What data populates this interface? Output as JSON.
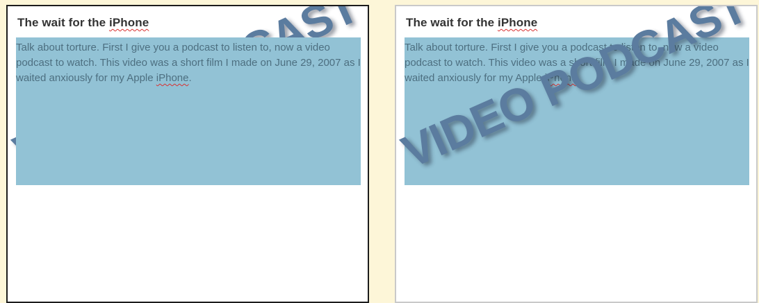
{
  "panels": [
    {
      "title_prefix": "The wait for the ",
      "title_link": "iPhone",
      "body_prefix": "Talk about torture. First I give you a podcast to listen to, now a video podcast to watch. This video was a short film I made on June 29, 2007 as I waited anxiously for my Apple ",
      "body_link": "iPhone",
      "body_suffix": ".",
      "stamp_text": "VIDEO PODCAST"
    },
    {
      "title_prefix": "The wait for the ",
      "title_link": "iPhone",
      "body_prefix": "Talk about torture. First I give you a podcast to listen to, now a video podcast to watch. This video was a short film I made on June 29, 2007 as I waited anxiously for my Apple ",
      "body_link": "iPhone",
      "body_suffix": ".",
      "stamp_text": "VIDEO PODCAST"
    }
  ],
  "colors": {
    "background": "#fdf6d8",
    "highlight": "#92c2d5",
    "stamp": "#5b7c9f",
    "spellcheck_underline": "#d83030"
  }
}
